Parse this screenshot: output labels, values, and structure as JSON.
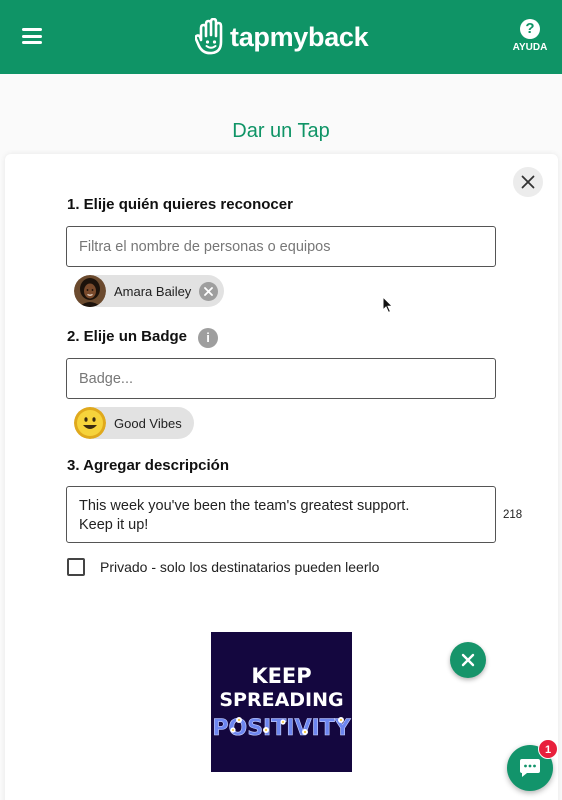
{
  "header": {
    "app_name": "tapmyback",
    "help_label": "AYUDA",
    "help_icon": "question-circle-icon",
    "brand_color": "#0f9466"
  },
  "page": {
    "title": "Dar un Tap"
  },
  "form": {
    "step1": {
      "label": "1. Elije quién quieres reconocer",
      "placeholder": "Filtra el nombre de personas o equipos",
      "selected_recipient": "Amara Bailey"
    },
    "step2": {
      "label": "2. Elije un Badge",
      "info_icon": "i",
      "placeholder": "Badge...",
      "selected_badge": "Good Vibes"
    },
    "step3": {
      "label": "3. Agregar descripción",
      "description_line1": "This week you've been the team's greatest support.",
      "description_line2": "Keep it up!",
      "char_count": "218"
    },
    "private_label": "Privado - solo los destinatarios pueden leerlo",
    "private_checked": false
  },
  "gif": {
    "line1": "KEEP",
    "line2": "SPREADING",
    "line3": "POSITIVITY"
  },
  "chat": {
    "badge_count": "1"
  }
}
